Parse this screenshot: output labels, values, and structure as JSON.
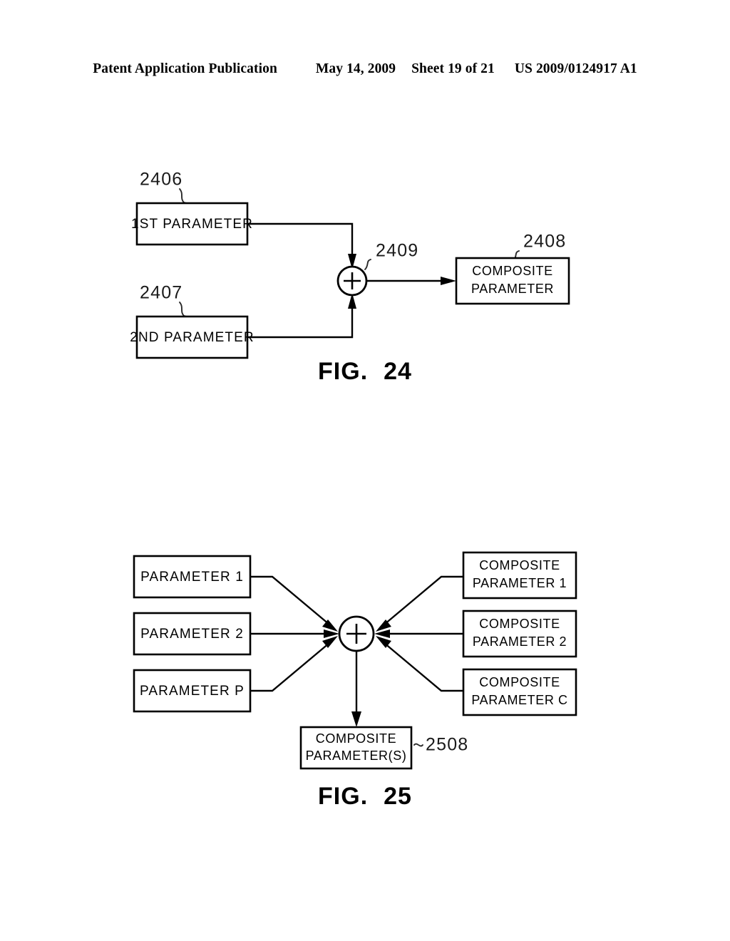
{
  "header": {
    "publication": "Patent Application Publication",
    "date": "May 14, 2009",
    "sheet": "Sheet 19 of 21",
    "patent_number": "US 2009/0124917 A1"
  },
  "figures": [
    {
      "caption_prefix": "FIG.",
      "caption_number": "24",
      "blocks": [
        {
          "id": "first-parameter",
          "label_line1": "1ST  PARAMETER",
          "ref": "2406"
        },
        {
          "id": "second-parameter",
          "label_line1": "2ND  PARAMETER",
          "ref": "2407"
        },
        {
          "id": "composite-parameter",
          "label_line1": "COMPOSITE",
          "label_line2": "PARAMETER",
          "ref": "2408"
        }
      ],
      "junction": {
        "id": "summing-junction",
        "symbol": "+",
        "ref": "2409"
      }
    },
    {
      "caption_prefix": "FIG.",
      "caption_number": "25",
      "inputs": [
        {
          "id": "parameter-1",
          "label_line1": "PARAMETER 1"
        },
        {
          "id": "parameter-2",
          "label_line1": "PARAMETER 2"
        },
        {
          "id": "parameter-p",
          "label_line1": "PARAMETER P"
        }
      ],
      "composites": [
        {
          "id": "composite-parameter-1",
          "label_line1": "COMPOSITE",
          "label_line2": "PARAMETER 1"
        },
        {
          "id": "composite-parameter-2",
          "label_line1": "COMPOSITE",
          "label_line2": "PARAMETER 2"
        },
        {
          "id": "composite-parameter-c",
          "label_line1": "COMPOSITE",
          "label_line2": "PARAMETER C"
        }
      ],
      "output": {
        "id": "composite-parameters-output",
        "label_line1": "COMPOSITE",
        "label_line2": "PARAMETER(S)",
        "ref": "2508"
      },
      "junction": {
        "id": "summing-junction",
        "symbol": "+"
      }
    }
  ]
}
